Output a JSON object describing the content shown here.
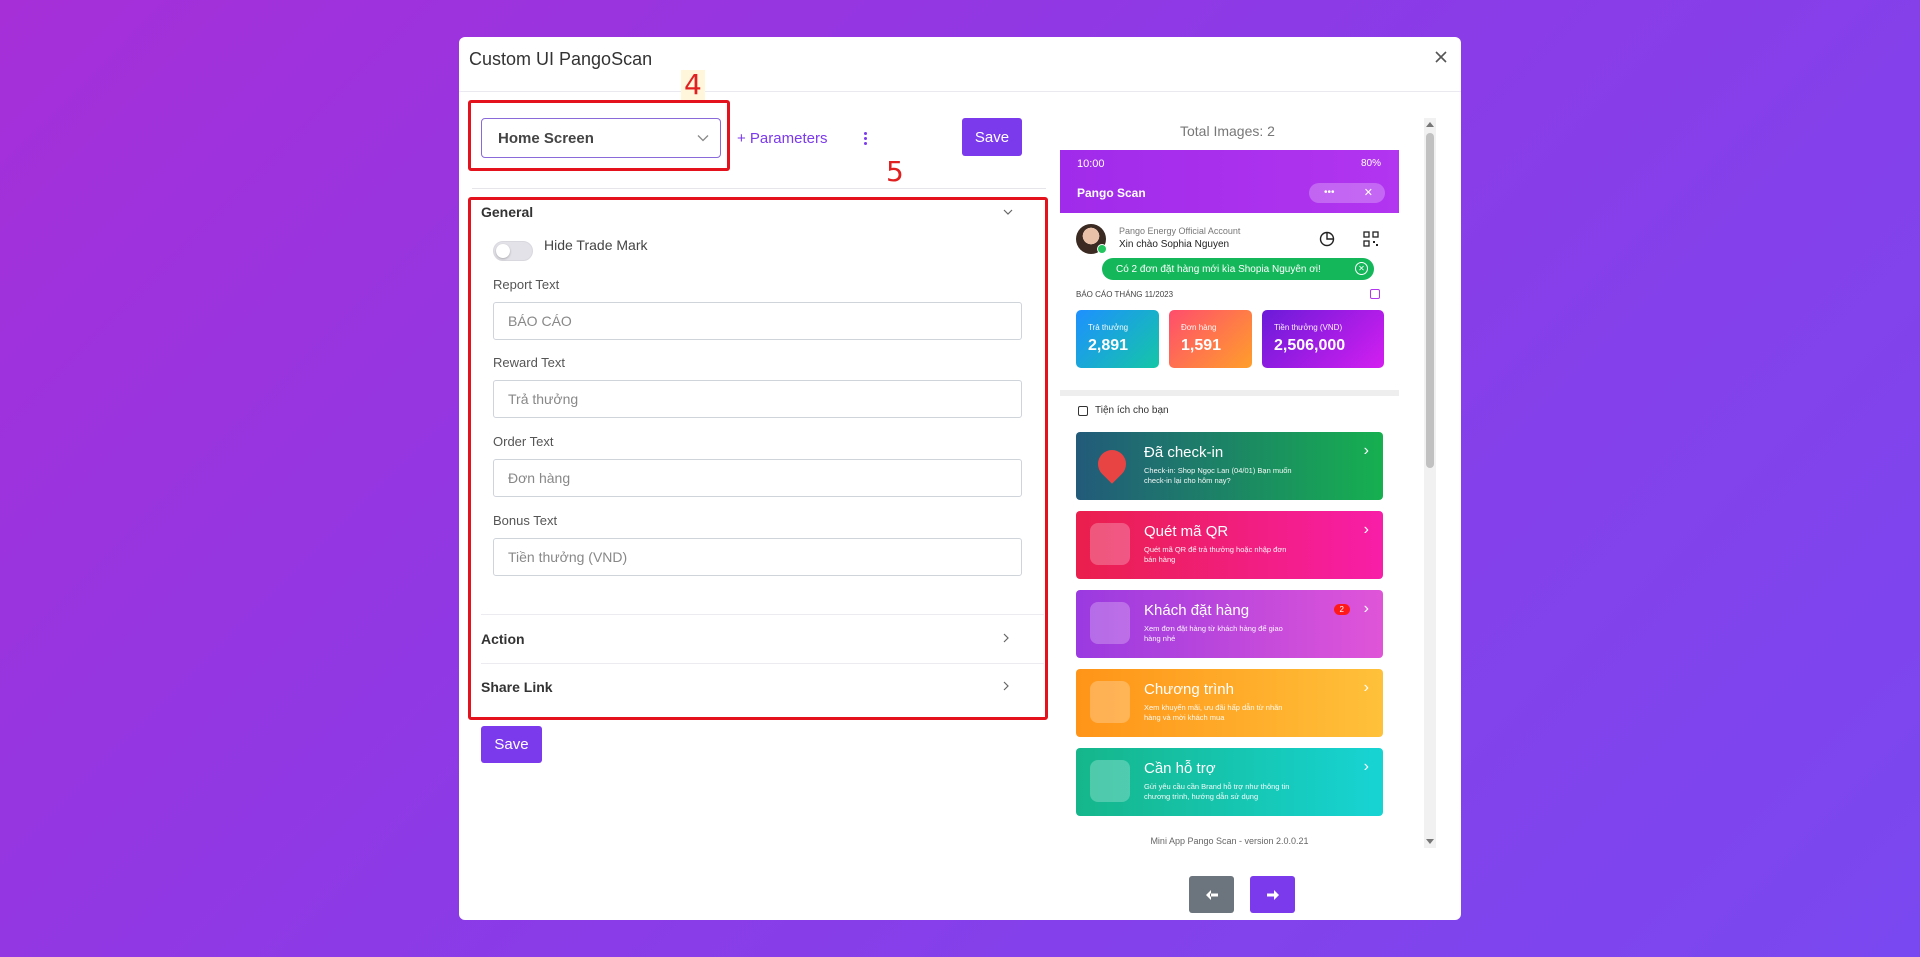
{
  "modal": {
    "title": "Custom UI PangoScan",
    "close_icon": "×"
  },
  "annotations": {
    "box4": "4",
    "box5": "5"
  },
  "toolbar": {
    "screen_select_value": "Home Screen",
    "parameters_label": "+ Parameters",
    "save_label": "Save"
  },
  "general": {
    "title": "General",
    "hide_trade_mark_label": "Hide Trade Mark",
    "hide_trade_mark_on": false,
    "fields": [
      {
        "label": "Report Text",
        "placeholder": "BÁO CÁO"
      },
      {
        "label": "Reward Text",
        "placeholder": "Trả thưởng"
      },
      {
        "label": "Order Text",
        "placeholder": "Đơn hàng"
      },
      {
        "label": "Bonus Text",
        "placeholder": "Tiền thưởng (VND)"
      }
    ]
  },
  "action": {
    "title": "Action"
  },
  "share_link": {
    "title": "Share Link"
  },
  "bottom": {
    "save_label": "Save"
  },
  "preview": {
    "total_images": "Total Images: 2",
    "status_time": "10:00",
    "status_right": "80%",
    "app_name": "Pango Scan",
    "account": "Pango Energy Official Account",
    "greeting": "Xin chào Sophia Nguyen",
    "notice": "Có 2 đơn đặt hàng mới kìa Shopia Nguyên ơi!",
    "report_title": "BÁO CÁO THÁNG 11/2023",
    "stats": [
      {
        "label": "Trả thưởng",
        "value": "2,891"
      },
      {
        "label": "Đơn hàng",
        "value": "1,591"
      },
      {
        "label": "Tiền thưởng (VND)",
        "value": "2,506,000"
      }
    ],
    "utilities_title": "Tiện ích cho bạn",
    "cards": [
      {
        "title": "Đã check-in",
        "desc": "Check-in: Shop Ngọc Lan (04/01) Bạn muốn check-in lại cho hôm nay?"
      },
      {
        "title": "Quét mã QR",
        "desc": "Quét mã QR để trả thưởng hoặc nhập đơn bán hàng"
      },
      {
        "title": "Khách đặt hàng",
        "desc": "Xem đơn đặt hàng từ khách hàng để giao hàng nhé",
        "badge": "2"
      },
      {
        "title": "Chương trình",
        "desc": "Xem khuyến mãi, ưu đãi hấp dẫn từ nhãn hàng và mời khách mua"
      },
      {
        "title": "Cần hỗ trợ",
        "desc": "Gửi yêu cầu cần Brand hỗ trợ như thông tin chương trình, hướng dẫn sử dụng"
      }
    ],
    "version": "Mini App Pango Scan - version 2.0.0.21"
  },
  "colors": {
    "accent": "#7c3aed",
    "annotation": "#e3121d"
  }
}
